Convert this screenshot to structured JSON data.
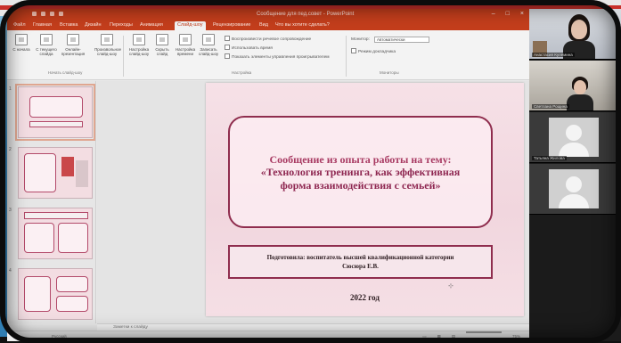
{
  "window": {
    "title": "Сообщение для пед.совет - PowerPoint"
  },
  "tabs": [
    {
      "label": "Файл"
    },
    {
      "label": "Главная"
    },
    {
      "label": "Вставка"
    },
    {
      "label": "Дизайн"
    },
    {
      "label": "Переходы"
    },
    {
      "label": "Анимация"
    },
    {
      "label": "Слайд-шоу",
      "active": true
    },
    {
      "label": "Рецензирование"
    },
    {
      "label": "Вид"
    },
    {
      "label": "Что вы хотите сделать?"
    }
  ],
  "ribbon": {
    "buttons": [
      {
        "label": "С начала"
      },
      {
        "label": "С текущего слайда"
      },
      {
        "label": "Онлайн-презентация"
      },
      {
        "label": "Произвольное слайд-шоу"
      },
      {
        "label": "Настройка слайд-шоу"
      },
      {
        "label": "Скрыть слайд"
      },
      {
        "label": "Настройка времени"
      },
      {
        "label": "Записать слайд-шоу"
      }
    ],
    "groups": [
      "Начать слайд-шоу",
      "Настройка",
      "Мониторы"
    ],
    "checks": [
      "Воспроизвести речевое сопровождение",
      "Использовать время",
      "Показать элементы управления проигрывателем"
    ],
    "monitor": {
      "label": "Монитор:",
      "value": "Автоматически",
      "presenter_view": "Режим докладчика"
    }
  },
  "thumbnails": [
    {
      "num": "1"
    },
    {
      "num": "2"
    },
    {
      "num": "3"
    },
    {
      "num": "4"
    }
  ],
  "slide": {
    "title_line1": "Сообщение из опыта работы на тему:",
    "title_line2": "«Технология тренинга, как эффективная",
    "title_line3": "форма взаимодействия с семьей»",
    "subtitle_line1": "Подготовила: воспитатель высшей квалификационной категории",
    "subtitle_line2": "Сюсюра Е.В.",
    "year": "2022 год"
  },
  "notes_placeholder": "Заметки к слайду",
  "status": {
    "left": "Русский",
    "zoom": "75%"
  },
  "participants": [
    {
      "name": "Анастасия Кулёмина"
    },
    {
      "name": "Светлана Рощина"
    },
    {
      "name": "Татьяна Жилова"
    },
    {
      "name": ""
    }
  ]
}
